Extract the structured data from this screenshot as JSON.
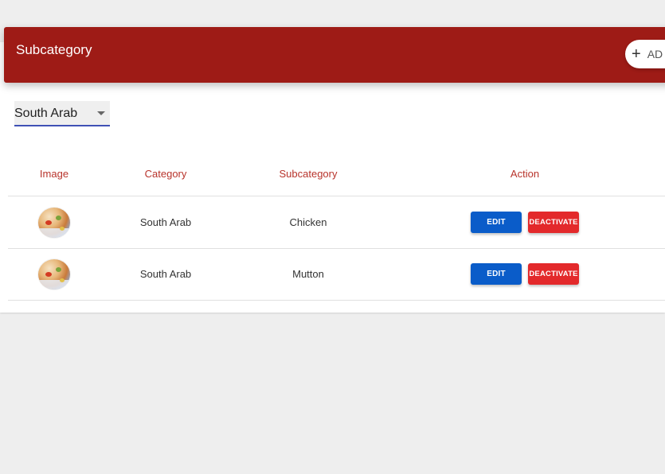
{
  "header": {
    "title": "Subcategory",
    "add_label": "AD"
  },
  "filter": {
    "selected": "South Arab"
  },
  "table": {
    "columns": [
      "Image",
      "Category",
      "Subcategory",
      "Action"
    ],
    "rows": [
      {
        "category": "South Arab",
        "subcategory": "Chicken",
        "edit_label": "EDIT",
        "deactivate_label": "DEACTIVATE"
      },
      {
        "category": "South Arab",
        "subcategory": "Mutton",
        "edit_label": "EDIT",
        "deactivate_label": "DEACTIVATE"
      }
    ]
  },
  "colors": {
    "header": "#9e1b16",
    "column_header_text": "#b8332b",
    "edit_button": "#0a5cc9",
    "deactivate_button": "#e3292b",
    "select_underline": "#3f51b5"
  }
}
